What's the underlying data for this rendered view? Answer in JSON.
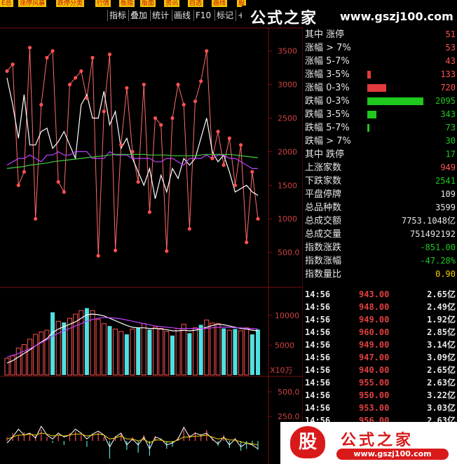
{
  "top_tabs": [
    "E总",
    "涨停风暴",
    "跌停分类",
    "行情",
    "板指",
    "版面",
    "资讯",
    "自选",
    "画线",
    "股"
  ],
  "toolbar": [
    "指标",
    "叠加",
    "统计",
    "画线",
    "F10",
    "标记",
    "+E"
  ],
  "watermark": {
    "top_cn": "公式之家",
    "top_url": "www.gszj100.com",
    "badge": "股",
    "bottom_cn": "公式之家",
    "bottom_url": "www.gszj100.com"
  },
  "colors": {
    "up": "#ff5050",
    "down": "#50e0e0",
    "grid": "#7a1010",
    "bar_red": "#e33b3b",
    "bar_green": "#1ec81e"
  },
  "stats": [
    {
      "label": "其中 涨停",
      "value": "51",
      "color": "#ff5050",
      "bar": 0,
      "barColor": ""
    },
    {
      "label": "涨幅 > 7%",
      "value": "53",
      "color": "#ff5050",
      "bar": 0,
      "barColor": ""
    },
    {
      "label": "涨幅 5-7%",
      "value": "43",
      "color": "#ff5050",
      "bar": 0,
      "barColor": ""
    },
    {
      "label": "涨幅 3-5%",
      "value": "133",
      "color": "#ff5050",
      "bar": 0.06,
      "barColor": "#e33b3b"
    },
    {
      "label": "涨幅 0-3%",
      "value": "720",
      "color": "#ff5050",
      "bar": 0.34,
      "barColor": "#e33b3b"
    },
    {
      "label": "跌幅 0-3%",
      "value": "2095",
      "color": "#1ec81e",
      "bar": 1.0,
      "barColor": "#1ec81e"
    },
    {
      "label": "跌幅 3-5%",
      "value": "343",
      "color": "#1ec81e",
      "bar": 0.16,
      "barColor": "#1ec81e"
    },
    {
      "label": "跌幅 5-7%",
      "value": "73",
      "color": "#1ec81e",
      "bar": 0.035,
      "barColor": "#1ec81e"
    },
    {
      "label": "跌幅 > 7%",
      "value": "30",
      "color": "#1ec81e",
      "bar": 0,
      "barColor": ""
    },
    {
      "label": "其中 跌停",
      "value": "17",
      "color": "#1ec81e",
      "bar": 0,
      "barColor": ""
    },
    {
      "label": "上涨家数",
      "value": "949",
      "color": "#ff5050",
      "bar": 0,
      "barColor": ""
    },
    {
      "label": "下跌家数",
      "value": "2541",
      "color": "#1ec81e",
      "bar": 0,
      "barColor": ""
    },
    {
      "label": "平盘停牌",
      "value": "109",
      "color": "#e6e6e6",
      "bar": 0,
      "barColor": ""
    },
    {
      "label": "总品种数",
      "value": "3599",
      "color": "#e6e6e6",
      "bar": 0,
      "barColor": ""
    },
    {
      "label": "总成交额",
      "value": "7753.1048亿",
      "color": "#e6e6e6",
      "bar": 0,
      "barColor": ""
    },
    {
      "label": "总成交量",
      "value": "751492192",
      "color": "#e6e6e6",
      "bar": 0,
      "barColor": ""
    },
    {
      "label": "指数涨跌",
      "value": "-851.00",
      "color": "#1ec81e",
      "bar": 0,
      "barColor": ""
    },
    {
      "label": "指数涨幅",
      "value": "-47.28%",
      "color": "#1ec81e",
      "bar": 0,
      "barColor": ""
    },
    {
      "label": "指数量比",
      "value": "0.90",
      "color": "#f0d000",
      "bar": 0,
      "barColor": ""
    }
  ],
  "ticks": [
    {
      "time": "14:56",
      "price": "943.00",
      "vol": "2.65亿"
    },
    {
      "time": "14:56",
      "price": "948.00",
      "vol": "2.49亿"
    },
    {
      "time": "14:56",
      "price": "949.00",
      "vol": "1.92亿"
    },
    {
      "time": "14:56",
      "price": "960.00",
      "vol": "2.85亿"
    },
    {
      "time": "14:56",
      "price": "949.00",
      "vol": "3.14亿"
    },
    {
      "time": "14:56",
      "price": "947.00",
      "vol": "3.09亿"
    },
    {
      "time": "14:56",
      "price": "940.00",
      "vol": "2.65亿"
    },
    {
      "time": "14:56",
      "price": "955.00",
      "vol": "2.63亿"
    },
    {
      "time": "14:56",
      "price": "950.00",
      "vol": "3.22亿"
    },
    {
      "time": "14:56",
      "price": "953.00",
      "vol": "3.03亿"
    },
    {
      "time": "14:56",
      "price": "956.00",
      "vol": "2.63亿"
    }
  ],
  "chart_data": [
    {
      "type": "line",
      "ylim": [
        0,
        3800
      ],
      "yticks": [
        "3500",
        "3000",
        "2500",
        "2000",
        "1500",
        "1000",
        "500.0"
      ],
      "series": [
        {
          "values": [
            3200,
            3300,
            1500,
            1700,
            3550,
            1000,
            2700,
            3400,
            3500,
            1550,
            1400,
            3000,
            3100,
            3200,
            2800,
            3400,
            450,
            2600,
            3450,
            530,
            2100,
            2950,
            2000,
            1550,
            3000,
            1100,
            2500,
            2400,
            520,
            2500,
            3000,
            2700,
            850,
            2750,
            3050,
            3500,
            1900,
            2300,
            1800,
            2200,
            1500,
            2100,
            650,
            1700,
            1000
          ]
        },
        {
          "values": [
            3100,
            2700,
            2200,
            2850,
            2100,
            2100,
            2300,
            2350,
            2050,
            2150,
            2300,
            2100,
            1900,
            2700,
            2850,
            2500,
            2500,
            2900,
            2400,
            2600,
            2050,
            2200,
            1900,
            1700,
            1500,
            1750,
            1300,
            1650,
            1400,
            1750,
            1600,
            1900,
            1800,
            1900,
            2200,
            2500,
            2000,
            1850,
            1950,
            1700,
            1400,
            1450,
            1500,
            1400,
            1350
          ]
        },
        {
          "values": [
            1800,
            1850,
            1900,
            1900,
            1950,
            1900,
            1850,
            1950,
            1950,
            2000,
            1950,
            1950,
            2000,
            2000,
            2000,
            1900,
            1900,
            1900,
            2000,
            1950,
            1950,
            1950,
            1900,
            1900,
            1900,
            1900,
            1850,
            1850,
            1900,
            1900,
            1850,
            1800,
            1900,
            1900,
            1900,
            1950,
            1900,
            1950,
            1950,
            1900,
            1900,
            1850,
            1800,
            1750,
            1750
          ]
        },
        {
          "values": [
            1750,
            1760,
            1770,
            1780,
            1800,
            1810,
            1820,
            1830,
            1850,
            1860,
            1870,
            1880,
            1890,
            1900,
            1910,
            1920,
            1930,
            1940,
            1950,
            1960,
            1960,
            1960,
            1960,
            1960,
            1960,
            1950,
            1950,
            1950,
            1950,
            1940,
            1940,
            1940,
            1940,
            1940,
            1950,
            1960,
            1960,
            1960,
            1960,
            1960,
            1950,
            1940,
            1930,
            1920,
            1910
          ]
        }
      ]
    },
    {
      "type": "bar",
      "ylim": [
        0,
        13500
      ],
      "yticks": [
        "10000",
        "5000"
      ],
      "unit": "X10万",
      "values": [
        2800,
        3200,
        4500,
        5100,
        6000,
        6800,
        7200,
        7500,
        10500,
        9000,
        8800,
        9500,
        10200,
        10800,
        11200,
        10800,
        9300,
        8600,
        8200,
        7700,
        7300,
        6800,
        7700,
        7900,
        8600,
        7600,
        8000,
        7800,
        7300,
        6600,
        7800,
        8500,
        7000,
        7900,
        8400,
        9200,
        8700,
        8600,
        7800,
        7500,
        7700,
        7400,
        7900,
        6800,
        7600
      ],
      "up": [
        true,
        true,
        true,
        true,
        true,
        true,
        true,
        true,
        false,
        true,
        false,
        true,
        true,
        true,
        false,
        true,
        true,
        true,
        false,
        true,
        true,
        false,
        true,
        false,
        true,
        false,
        true,
        true,
        true,
        false,
        true,
        true,
        false,
        true,
        false,
        true,
        true,
        true,
        false,
        true,
        false,
        true,
        true,
        false,
        false
      ],
      "ma_a": [
        2000,
        2400,
        3000,
        3600,
        4200,
        4900,
        5500,
        6100,
        7100,
        7700,
        8100,
        8500,
        8900,
        9500,
        10100,
        10200,
        10100,
        9900,
        9500,
        9100,
        8700,
        8300,
        8000,
        7900,
        7900,
        7800,
        7800,
        7700,
        7600,
        7400,
        7400,
        7500,
        7400,
        7500,
        7700,
        8000,
        8300,
        8500,
        8400,
        8200,
        8000,
        7800,
        7700,
        7500,
        7400
      ],
      "ma_b": [
        3000,
        3300,
        3600,
        4000,
        4400,
        4900,
        5400,
        5900,
        6500,
        7000,
        7400,
        7800,
        8200,
        8600,
        9000,
        9300,
        9500,
        9600,
        9600,
        9500,
        9400,
        9200,
        9000,
        8800,
        8600,
        8400,
        8200,
        8100,
        8000,
        7900,
        7800,
        7800,
        7800,
        7800,
        7800,
        7800,
        7900,
        8000,
        8000,
        8000,
        7900,
        7900,
        7800,
        7800,
        7700
      ]
    },
    {
      "type": "bar",
      "ylim": [
        -220,
        600
      ],
      "yticks": [
        "500.0",
        "250.0"
      ],
      "values": [
        40,
        80,
        60,
        90,
        70,
        50,
        120,
        40,
        -20,
        60,
        -40,
        80,
        100,
        60,
        -60,
        70,
        90,
        40,
        -180,
        50,
        80,
        -90,
        40,
        -120,
        60,
        -150,
        50,
        20,
        -80,
        -60,
        40,
        120,
        60,
        90,
        70,
        110,
        40,
        -50,
        60,
        -70,
        30,
        -100,
        -80,
        -40,
        -90
      ],
      "line_a": [
        -20,
        40,
        120,
        60,
        80,
        30,
        150,
        60,
        20,
        80,
        40,
        60,
        120,
        80,
        20,
        70,
        100,
        60,
        -60,
        40,
        80,
        -40,
        20,
        -40,
        40,
        -80,
        40,
        20,
        -40,
        -20,
        20,
        140,
        40,
        80,
        60,
        80,
        20,
        -30,
        40,
        -40,
        20,
        -60,
        -20,
        -40,
        -80
      ],
      "line_b": [
        20,
        40,
        60,
        60,
        70,
        60,
        80,
        70,
        50,
        60,
        50,
        60,
        70,
        70,
        50,
        60,
        70,
        60,
        20,
        30,
        50,
        20,
        20,
        0,
        20,
        -20,
        10,
        10,
        -10,
        -10,
        10,
        40,
        40,
        50,
        50,
        60,
        40,
        20,
        30,
        10,
        10,
        -10,
        -20,
        -30,
        -40
      ]
    }
  ]
}
